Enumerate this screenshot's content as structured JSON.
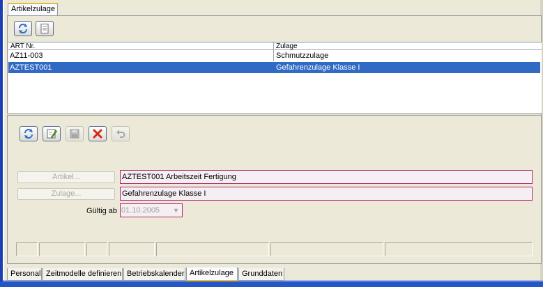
{
  "top_tab": {
    "label": "Artikelzulage"
  },
  "table": {
    "columns": [
      "ART Nr.",
      "Zulage"
    ],
    "rows": [
      {
        "art_nr": "AZ11-003",
        "zulage": "Schmutzzulage",
        "selected": false
      },
      {
        "art_nr": "AZTEST001",
        "zulage": "Gefahrenzulage Klasse I",
        "selected": true
      }
    ]
  },
  "toolbar_top": [
    {
      "icon": "refresh-icon"
    },
    {
      "icon": "document-icon"
    }
  ],
  "toolbar_detail": [
    {
      "icon": "refresh-icon",
      "enabled": true
    },
    {
      "icon": "edit-icon",
      "enabled": true
    },
    {
      "icon": "save-icon",
      "enabled": false
    },
    {
      "icon": "delete-icon",
      "enabled": true
    },
    {
      "icon": "undo-icon",
      "enabled": false
    }
  ],
  "form": {
    "artikel": {
      "button_label": "Artikel...",
      "value": "AZTEST001 Arbeitszeit Fertigung"
    },
    "zulage": {
      "button_label": "Zulage...",
      "value": "Gefahrenzulage Klasse I"
    },
    "gueltig_ab": {
      "label": "Gültig ab",
      "value": "01.10.2005"
    }
  },
  "bottom_tabs": [
    {
      "label": "Personal",
      "active": false
    },
    {
      "label": "Zeitmodelle definieren",
      "active": false
    },
    {
      "label": "Betriebskalender",
      "active": false
    },
    {
      "label": "Artikelzulage",
      "active": true
    },
    {
      "label": "Grunddaten",
      "active": false
    }
  ],
  "colors": {
    "selection": "#316ac5",
    "required_field_border": "#b0296e",
    "active_tab_accent": "#e9b93a",
    "window_frame": "#1c3fb4"
  }
}
